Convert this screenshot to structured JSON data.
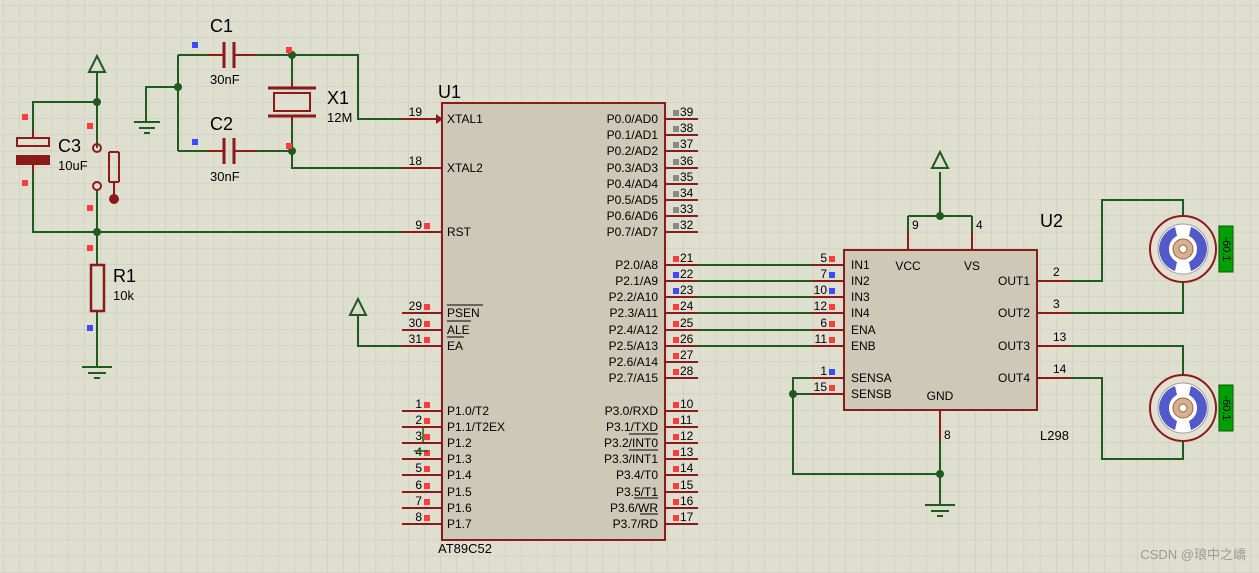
{
  "colors": {
    "background": "#dfdfd0",
    "grid": "#c9c9b8",
    "wire": "#1f5a1f",
    "component": "#8b1a1a",
    "chip_fill": "#cdc9b6",
    "pin_red": "#ff3b3b",
    "pin_blue": "#3b4bff",
    "pin_gray": "#8a8a8a",
    "motor_blue": "#5259c8",
    "probe_green": "#00a000"
  },
  "components": {
    "c1": {
      "ref": "C1",
      "value": "30nF"
    },
    "c2": {
      "ref": "C2",
      "value": "30nF"
    },
    "c3": {
      "ref": "C3",
      "value": "10uF"
    },
    "x1": {
      "ref": "X1",
      "value": "12M"
    },
    "r1": {
      "ref": "R1",
      "value": "10k"
    }
  },
  "u1": {
    "ref": "U1",
    "part": "AT89C52",
    "left_pins": [
      {
        "num": "19",
        "name": "XTAL1"
      },
      {
        "num": "18",
        "name": "XTAL2"
      },
      {
        "num": "9",
        "name": "RST"
      },
      {
        "num": "29",
        "name": "PSEN"
      },
      {
        "num": "30",
        "name": "ALE"
      },
      {
        "num": "31",
        "name": "EA"
      },
      {
        "num": "1",
        "name": "P1.0/T2"
      },
      {
        "num": "2",
        "name": "P1.1/T2EX"
      },
      {
        "num": "3",
        "name": "P1.2"
      },
      {
        "num": "4",
        "name": "P1.3"
      },
      {
        "num": "5",
        "name": "P1.4"
      },
      {
        "num": "6",
        "name": "P1.5"
      },
      {
        "num": "7",
        "name": "P1.6"
      },
      {
        "num": "8",
        "name": "P1.7"
      }
    ],
    "right_pins": [
      {
        "num": "39",
        "name": "P0.0/AD0"
      },
      {
        "num": "38",
        "name": "P0.1/AD1"
      },
      {
        "num": "37",
        "name": "P0.2/AD2"
      },
      {
        "num": "36",
        "name": "P0.3/AD3"
      },
      {
        "num": "35",
        "name": "P0.4/AD4"
      },
      {
        "num": "34",
        "name": "P0.5/AD5"
      },
      {
        "num": "33",
        "name": "P0.6/AD6"
      },
      {
        "num": "32",
        "name": "P0.7/AD7"
      },
      {
        "num": "21",
        "name": "P2.0/A8"
      },
      {
        "num": "22",
        "name": "P2.1/A9"
      },
      {
        "num": "23",
        "name": "P2.2/A10"
      },
      {
        "num": "24",
        "name": "P2.3/A11"
      },
      {
        "num": "25",
        "name": "P2.4/A12"
      },
      {
        "num": "26",
        "name": "P2.5/A13"
      },
      {
        "num": "27",
        "name": "P2.6/A14"
      },
      {
        "num": "28",
        "name": "P2.7/A15"
      },
      {
        "num": "10",
        "name": "P3.0/RXD"
      },
      {
        "num": "11",
        "name": "P3.1/TXD"
      },
      {
        "num": "12",
        "name": "P3.2/INT0"
      },
      {
        "num": "13",
        "name": "P3.3/INT1"
      },
      {
        "num": "14",
        "name": "P3.4/T0"
      },
      {
        "num": "15",
        "name": "P3.5/T1"
      },
      {
        "num": "16",
        "name": "P3.6/WR"
      },
      {
        "num": "17",
        "name": "P3.7/RD"
      }
    ]
  },
  "u2": {
    "ref": "U2",
    "part": "L298",
    "left_pins": [
      {
        "num": "5",
        "name": "IN1"
      },
      {
        "num": "7",
        "name": "IN2"
      },
      {
        "num": "10",
        "name": "IN3"
      },
      {
        "num": "12",
        "name": "IN4"
      },
      {
        "num": "6",
        "name": "ENA"
      },
      {
        "num": "11",
        "name": "ENB"
      },
      {
        "num": "1",
        "name": "SENSA"
      },
      {
        "num": "15",
        "name": "SENSB"
      }
    ],
    "right_pins": [
      {
        "num": "2",
        "name": "OUT1"
      },
      {
        "num": "3",
        "name": "OUT2"
      },
      {
        "num": "13",
        "name": "OUT3"
      },
      {
        "num": "14",
        "name": "OUT4"
      }
    ],
    "top_pins": [
      {
        "num": "9",
        "name": "VCC"
      },
      {
        "num": "4",
        "name": "VS"
      }
    ],
    "bottom_pins": [
      {
        "num": "8",
        "name": "GND"
      }
    ]
  },
  "motors": [
    {
      "reading": "-60.1"
    },
    {
      "reading": "-60.1"
    }
  ],
  "watermark": "CSDN @琅中之嶠"
}
